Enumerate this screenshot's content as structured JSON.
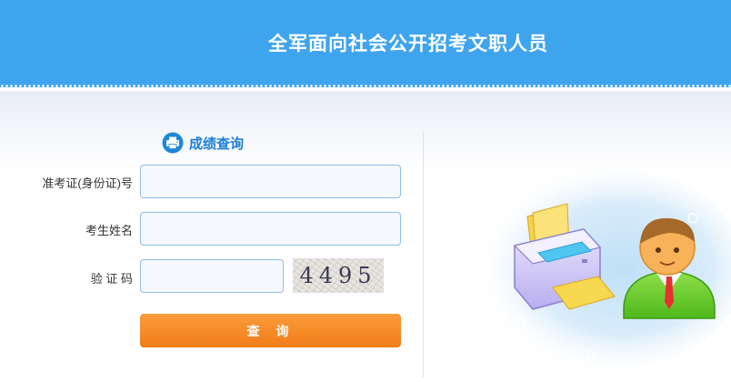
{
  "header": {
    "title": "全军面向社会公开招考文职人员"
  },
  "panel": {
    "title": "成绩查询"
  },
  "form": {
    "id_label": "准考证(身份证)号",
    "id_value": "",
    "name_label": "考生姓名",
    "name_value": "",
    "captcha_label": "验 证 码",
    "captcha_value": "",
    "captcha_text": "4495",
    "submit_label": "查询"
  },
  "icons": {
    "panel_icon": "printer-icon",
    "illustration": "printer-and-person-illustration"
  },
  "colors": {
    "header": "#3fa4ee",
    "accent": "#1b7fd6",
    "button": "#f5891f",
    "input_border": "#8fbde6"
  }
}
